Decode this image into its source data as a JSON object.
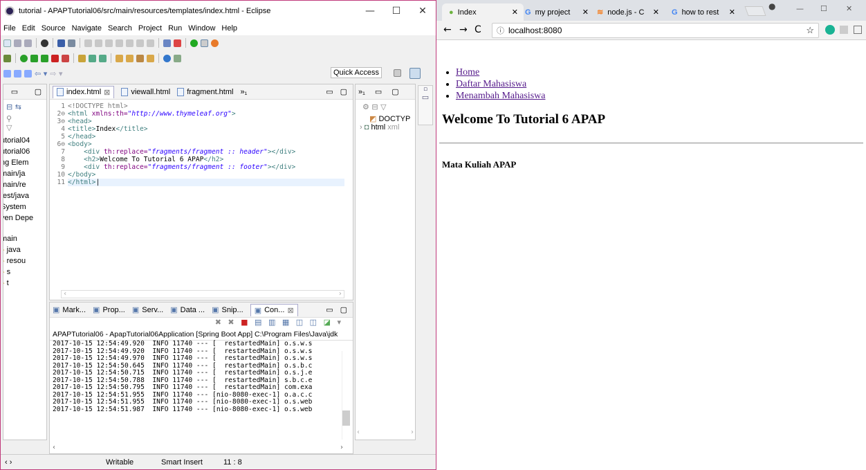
{
  "eclipse": {
    "title": "tutorial - APAPTutorial06/src/main/resources/templates/index.html - Eclipse",
    "menu": [
      "File",
      "Edit",
      "Source",
      "Navigate",
      "Search",
      "Project",
      "Run",
      "Window",
      "Help"
    ],
    "quick_access": "Quick Access",
    "explorer_items": [
      "utorial04",
      "utorial06",
      "ng Elem",
      "main/ja",
      "main/re",
      "test/java",
      "System",
      "ven Depe",
      "main",
      "java",
      "resou",
      "s",
      "t"
    ],
    "editor_tabs": [
      {
        "label": "index.html",
        "close": "⊠"
      },
      {
        "label": "viewall.html"
      },
      {
        "label": "fragment.html"
      },
      {
        "label": "»₁"
      }
    ],
    "code_lines": [
      {
        "n": "1",
        "parts": [
          [
            "t",
            "<!DOCTYPE html>"
          ]
        ]
      },
      {
        "n": "2⊖",
        "parts": [
          [
            "t",
            "<html "
          ],
          [
            "a",
            "xmlns:th="
          ],
          [
            "s",
            "\"http://www.thymeleaf.org\""
          ],
          [
            "t",
            ">"
          ]
        ]
      },
      {
        "n": "3⊖",
        "parts": [
          [
            "t",
            "<head>"
          ]
        ]
      },
      {
        "n": "4",
        "parts": [
          [
            "t",
            "<title>"
          ],
          [
            "p",
            "Index"
          ],
          [
            "t",
            "</title>"
          ]
        ]
      },
      {
        "n": "5",
        "parts": [
          [
            "t",
            "</head>"
          ]
        ]
      },
      {
        "n": "6⊖",
        "parts": [
          [
            "t",
            "<body>"
          ]
        ]
      },
      {
        "n": "7",
        "parts": [
          [
            "p",
            "    "
          ],
          [
            "t",
            "<div "
          ],
          [
            "a",
            "th:replace="
          ],
          [
            "s",
            "\"fragments/fragment :: header\""
          ],
          [
            "t",
            "></div>"
          ]
        ]
      },
      {
        "n": "8",
        "parts": [
          [
            "p",
            "    "
          ],
          [
            "t",
            "<h2>"
          ],
          [
            "p",
            "Welcome To Tutorial 6 APAP"
          ],
          [
            "t",
            "</h2>"
          ]
        ]
      },
      {
        "n": "9",
        "parts": [
          [
            "p",
            "    "
          ],
          [
            "t",
            "<div "
          ],
          [
            "a",
            "th:replace="
          ],
          [
            "s",
            "\"fragments/fragment :: footer\""
          ],
          [
            "t",
            "></div>"
          ]
        ]
      },
      {
        "n": "10",
        "parts": [
          [
            "t",
            "</body>"
          ]
        ]
      },
      {
        "n": "11",
        "parts": [
          [
            "t",
            "</html>"
          ]
        ]
      }
    ],
    "outline_header": "»₁",
    "outline_items": [
      "DOCTYP",
      "html"
    ],
    "outline_html_suffix": "xml",
    "bottom_tabs": [
      "Mark...",
      "Prop...",
      "Serv...",
      "Data ...",
      "Snip...",
      "Con..."
    ],
    "console_header": "APAPTutorial06 - ApapTutorial06Application [Spring Boot App] C:\\Program Files\\Java\\jdk",
    "console_lines": [
      "2017-10-15 12:54:49.920  INFO 11740 --- [  restartedMain] o.s.w.s",
      "2017-10-15 12:54:49.920  INFO 11740 --- [  restartedMain] o.s.w.s",
      "2017-10-15 12:54:49.970  INFO 11740 --- [  restartedMain] o.s.w.s",
      "2017-10-15 12:54:50.645  INFO 11740 --- [  restartedMain] o.s.b.c",
      "2017-10-15 12:54:50.715  INFO 11740 --- [  restartedMain] o.s.j.e",
      "2017-10-15 12:54:50.788  INFO 11740 --- [  restartedMain] s.b.c.e",
      "2017-10-15 12:54:50.795  INFO 11740 --- [  restartedMain] com.exa",
      "2017-10-15 12:54:51.955  INFO 11740 --- [nio-8080-exec-1] o.a.c.c",
      "2017-10-15 12:54:51.955  INFO 11740 --- [nio-8080-exec-1] o.s.web",
      "2017-10-15 12:54:51.987  INFO 11740 --- [nio-8080-exec-1] o.s.web"
    ],
    "status": {
      "writable": "Writable",
      "insert": "Smart Insert",
      "position": "11 : 8"
    }
  },
  "chrome": {
    "tabs": [
      "Index",
      "my project",
      "node.js - C",
      "how to rest"
    ],
    "url": "localhost:8080",
    "page": {
      "nav_links": [
        "Home",
        "Daftar Mahasiswa",
        "Menambah Mahasiswa"
      ],
      "heading": "Welcome To Tutorial 6 APAP",
      "footer": "Mata Kuliah APAP"
    }
  },
  "colors": {
    "accent": "#c0397b",
    "link": "#551a8b",
    "tag": "#3f7f7f",
    "attr": "#7f007f",
    "string": "#2a00ff"
  }
}
